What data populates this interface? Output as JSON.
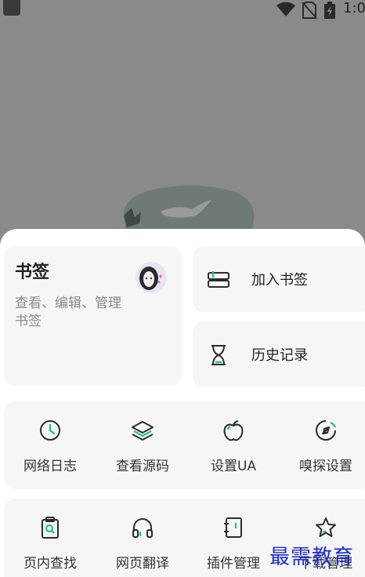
{
  "status_bar": {
    "time": "1:0",
    "icons": [
      "wifi-icon",
      "no-sim-icon",
      "battery-icon"
    ]
  },
  "bookmark_card": {
    "title": "书签",
    "description": "查看、编辑、管理书签"
  },
  "actions": [
    {
      "label": "加入书签",
      "icon": "bookmark-add-icon"
    },
    {
      "label": "历史记录",
      "icon": "hourglass-icon"
    }
  ],
  "tools_row1": [
    {
      "label": "网络日志",
      "icon": "clock-icon"
    },
    {
      "label": "查看源码",
      "icon": "layers-icon"
    },
    {
      "label": "设置UA",
      "icon": "apple-icon"
    },
    {
      "label": "嗅探设置",
      "icon": "compass-icon"
    }
  ],
  "tools_row2": [
    {
      "label": "页内查找",
      "icon": "clipboard-search-icon"
    },
    {
      "label": "网页翻译",
      "icon": "headphones-icon"
    },
    {
      "label": "插件管理",
      "icon": "notebook-icon"
    },
    {
      "label": "下载管理",
      "icon": "star-icon"
    }
  ],
  "watermark": "最需教育",
  "colors": {
    "accent": "#1fc28c",
    "icon_stroke": "#2b2b2b",
    "card_bg": "#f6f6f6",
    "scrim": "#8a8a8a"
  }
}
